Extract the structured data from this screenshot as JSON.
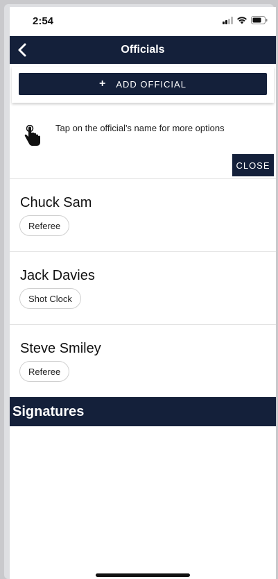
{
  "status_bar": {
    "time": "2:54"
  },
  "navbar": {
    "title": "Officials"
  },
  "add_official": {
    "label": "ADD OFFICIAL",
    "plus": "+"
  },
  "hint": {
    "text": "Tap on the official's name for more options"
  },
  "close_button": {
    "label": "CLOSE"
  },
  "officials": [
    {
      "name": "Chuck Sam",
      "role": "Referee"
    },
    {
      "name": "Jack Davies",
      "role": "Shot Clock"
    },
    {
      "name": "Steve Smiley",
      "role": "Referee"
    }
  ],
  "signatures": {
    "title": "Signatures"
  },
  "colors": {
    "navy": "#14203a",
    "background": "#ffffff"
  },
  "icons": [
    "back-chevron-icon",
    "plus-icon",
    "tap-hand-icon",
    "signal-icon",
    "wifi-icon",
    "battery-icon"
  ]
}
